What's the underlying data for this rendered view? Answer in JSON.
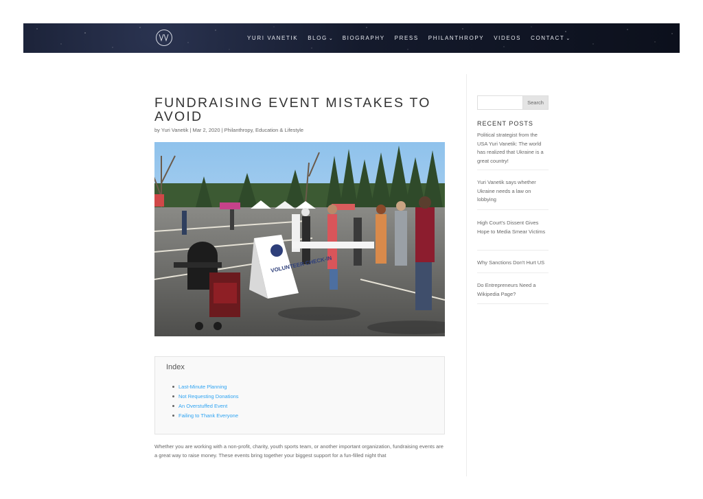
{
  "header": {
    "logo_label": "YV",
    "nav": [
      {
        "label": "YURI VANETIK",
        "has_dropdown": false
      },
      {
        "label": "BLOG",
        "has_dropdown": true
      },
      {
        "label": "BIOGRAPHY",
        "has_dropdown": false
      },
      {
        "label": "PRESS",
        "has_dropdown": false
      },
      {
        "label": "PHILANTHROPY",
        "has_dropdown": false
      },
      {
        "label": "VIDEOS",
        "has_dropdown": false
      },
      {
        "label": "CONTACT",
        "has_dropdown": true
      }
    ]
  },
  "post": {
    "title": "FUNDRAISING EVENT MISTAKES TO AVOID",
    "meta": {
      "by": "by",
      "author": "Yuri Vanetik",
      "sep1": "|",
      "date": "Mar 2, 2020",
      "sep2": "|",
      "category1": "Philanthropy",
      "comma": ",",
      "category2": "Education & Lifestyle"
    },
    "image_sign_text": "VOLUNTEER CHECK-IN",
    "index": {
      "title": "Index",
      "items": [
        "Last-Minute Planning",
        "Not Requesting Donations",
        "An Overstuffed Event",
        "Failing to Thank Everyone"
      ]
    },
    "body": "Whether you are working with a non-profit, charity, youth sports team, or another important organization, fundraising events are a great way to raise money. These events bring together your biggest support for a fun-filled night that"
  },
  "sidebar": {
    "search_placeholder": "",
    "search_button": "Search",
    "recent_heading": "RECENT POSTS",
    "recent_posts": [
      "Political strategist from the USA Yuri Vanetik: The world has realized that Ukraine is a great country!",
      "Yuri Vanetik says whether Ukraine needs a law on lobbying",
      "High Court's Dissent Gives Hope to Media Smear Victims",
      "Why Sanctions Don't Hurt US",
      "Do Entrepreneurs Need a Wikipedia Page?"
    ]
  },
  "colors": {
    "link": "#2ea3f2",
    "header_bg": "#141a2c",
    "text": "#666666",
    "title": "#333333"
  }
}
